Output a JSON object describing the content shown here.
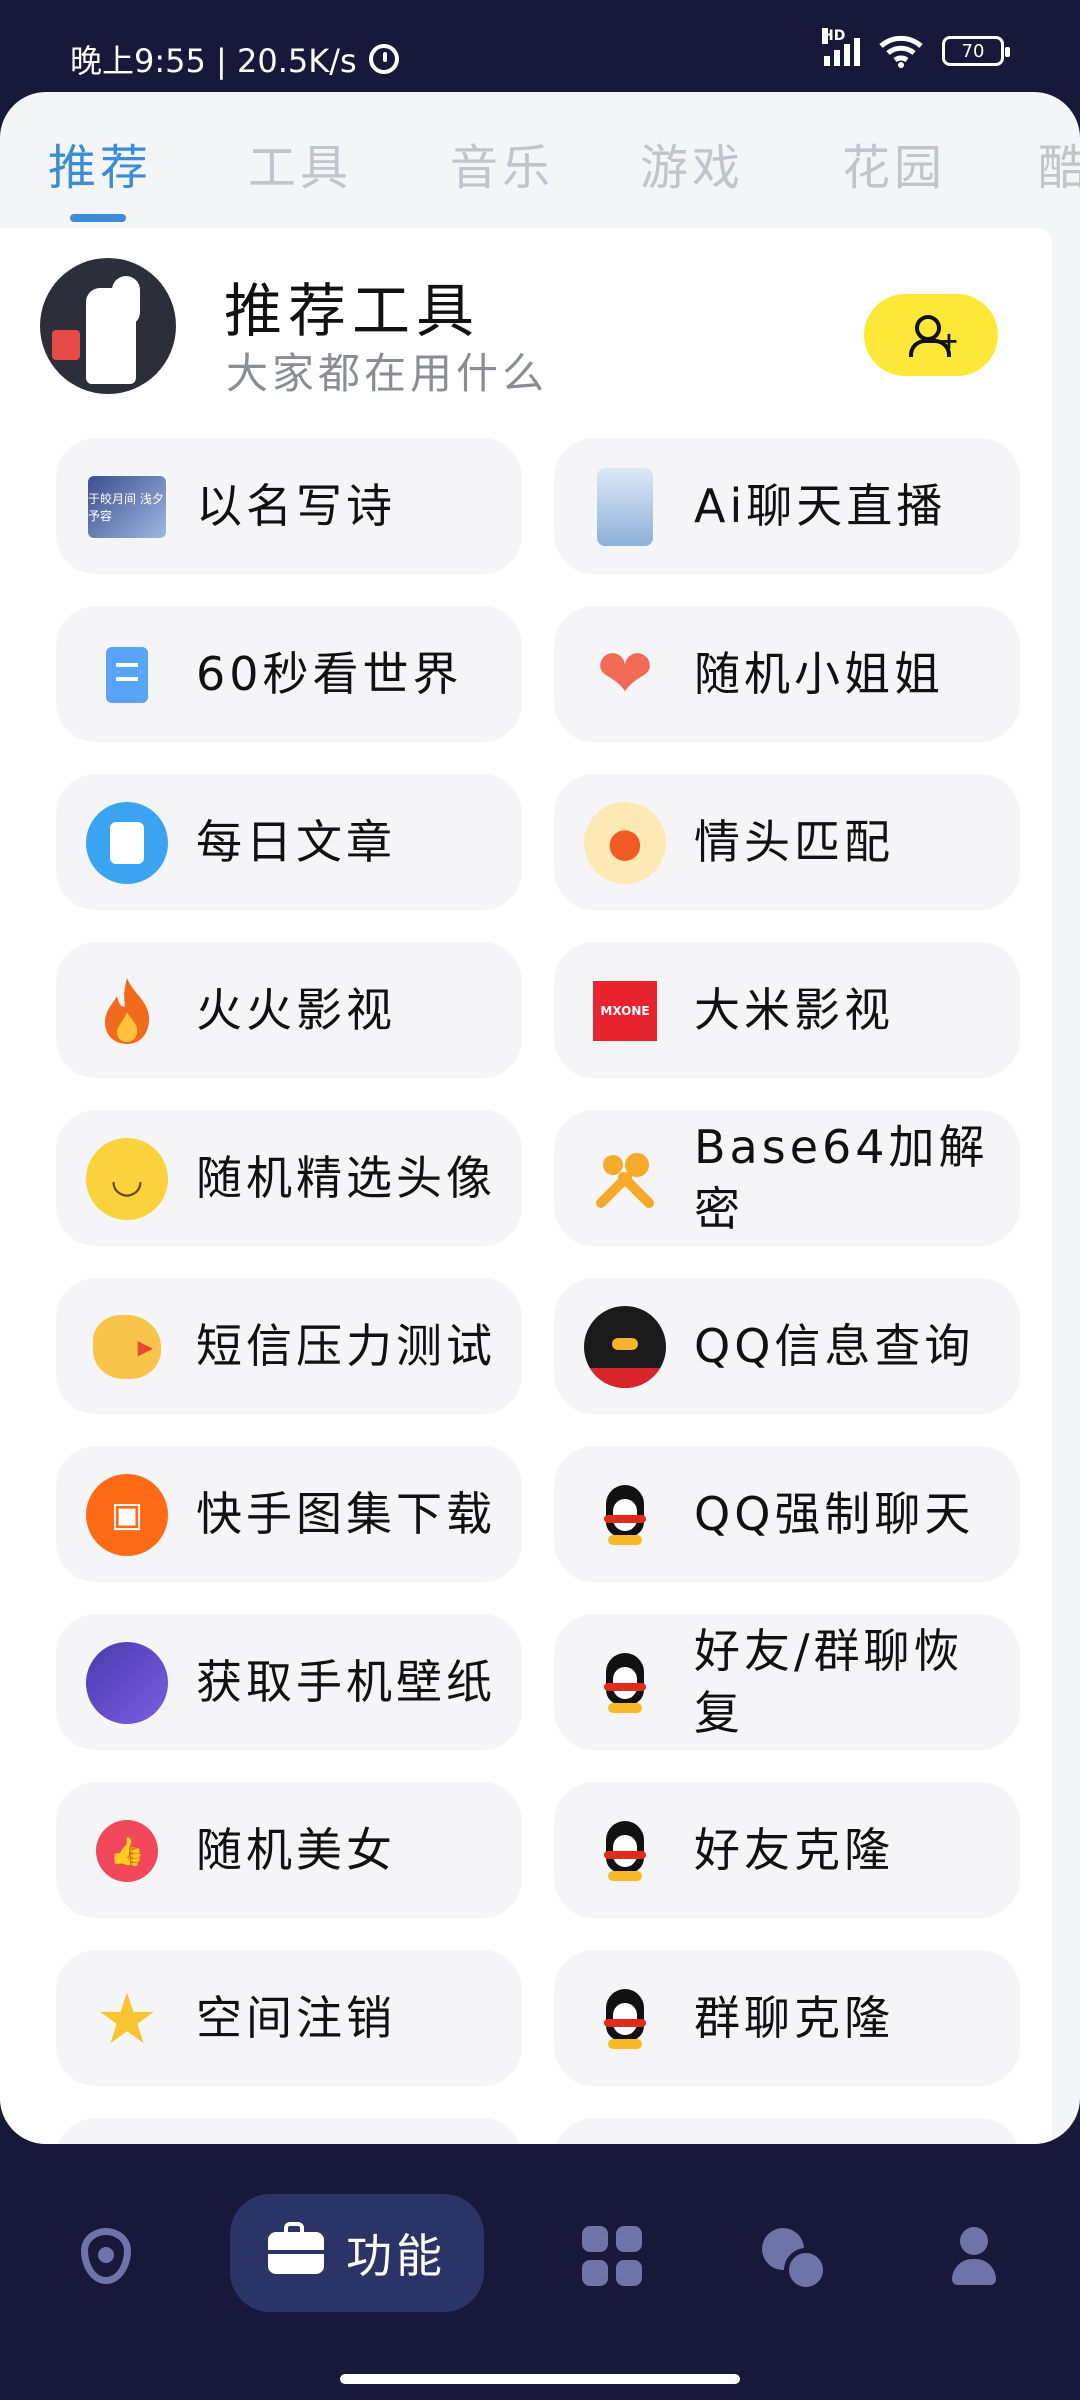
{
  "status": {
    "time_net": "晚上9:55 | 20.5K/s",
    "hd": "HD",
    "battery": "70"
  },
  "tabs": [
    "推荐",
    "工具",
    "音乐",
    "游戏",
    "花园",
    "酷"
  ],
  "header": {
    "title": "推荐工具",
    "subtitle": "大家都在用什么"
  },
  "items": [
    {
      "label": "以名写诗",
      "icon": "poem-image-icon",
      "icon_text": "于皎月间 浅夕予容"
    },
    {
      "label": "Ai聊天直播",
      "icon": "anime-girl-icon"
    },
    {
      "label": "60秒看世界",
      "icon": "scroll-doc-icon"
    },
    {
      "label": "随机小姐姐",
      "icon": "heart-icon"
    },
    {
      "label": "每日文章",
      "icon": "article-icon"
    },
    {
      "label": "情头匹配",
      "icon": "flame-circle-icon"
    },
    {
      "label": "火火影视",
      "icon": "fire-icon"
    },
    {
      "label": "大米影视",
      "icon": "mxone-logo-icon",
      "icon_text": "MXONE"
    },
    {
      "label": "随机精选头像",
      "icon": "smirk-face-icon"
    },
    {
      "label": "Base64加解密",
      "icon": "wrench-icon"
    },
    {
      "label": "短信压力测试",
      "icon": "chick-icon"
    },
    {
      "label": "QQ信息查询",
      "icon": "qq-penguin-icon"
    },
    {
      "label": "快手图集下载",
      "icon": "kuaishou-icon"
    },
    {
      "label": "QQ强制聊天",
      "icon": "qq-penguin-icon"
    },
    {
      "label": "获取手机壁纸",
      "icon": "wallpaper-icon"
    },
    {
      "label": "好友/群聊恢复",
      "icon": "qq-penguin-icon"
    },
    {
      "label": "随机美女",
      "icon": "tomato-like-icon"
    },
    {
      "label": "好友克隆",
      "icon": "qq-penguin-icon"
    },
    {
      "label": "空间注销",
      "icon": "qzone-star-icon"
    },
    {
      "label": "群聊克隆",
      "icon": "qq-penguin-icon"
    }
  ],
  "bottom_nav": {
    "active_label": "功能"
  },
  "colors": {
    "accent": "#3b8dd6",
    "follow": "#fde83a",
    "nav_bg": "#17183a",
    "nav_active": "#2a3466"
  }
}
